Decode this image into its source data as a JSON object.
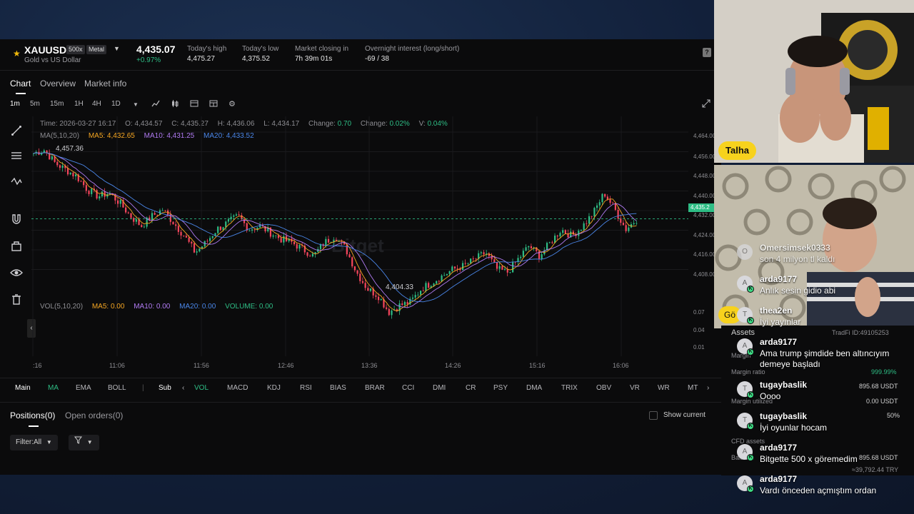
{
  "header": {
    "symbol": "XAUUSD",
    "leverage": "500x",
    "category": "Metal",
    "subtitle": "Gold vs US Dollar",
    "price": "4,435.07",
    "change_pct": "+0.97%",
    "stats": [
      {
        "label": "Today's high",
        "value": "4,475.27"
      },
      {
        "label": "Today's low",
        "value": "4,375.52"
      },
      {
        "label": "Market closing in",
        "value": "7h 39m 01s"
      },
      {
        "label": "Overnight interest (long/short)",
        "value": "-69 / 38"
      }
    ],
    "help": "?"
  },
  "tabs": [
    "Chart",
    "Overview",
    "Market info"
  ],
  "timeframes": [
    "1m",
    "5m",
    "15m",
    "1H",
    "4H",
    "1D"
  ],
  "legend": {
    "time": "Time: 2026-03-27 16:17",
    "open": "O: 4,434.57",
    "close": "C: 4,435.27",
    "high": "H: 4,436.06",
    "low": "L: 4,434.17",
    "change": "Change:",
    "change_val": "0.70",
    "change_pct": "Change:",
    "change_pct_val": "0.02%",
    "v": "V:",
    "v_val": "0.04%",
    "ma_label": "MA(5,10,20)",
    "ma5": "MA5: 4,432.65",
    "ma10": "MA10: 4,431.25",
    "ma20": "MA20: 4,433.52",
    "vol_label": "VOL(5,10,20)",
    "vol_ma5": "MA5: 0.00",
    "vol_ma10": "MA10: 0.00",
    "vol_ma20": "MA20: 0.00",
    "volume": "VOLUME: 0.00"
  },
  "chart_annotations": {
    "high_mark": "4,457.36",
    "low_mark": "4,404.33"
  },
  "chart_data": {
    "type": "candlestick",
    "x_ticks": [
      ":16",
      "11:06",
      "11:56",
      "12:46",
      "13:36",
      "14:26",
      "15:16",
      "16:06"
    ],
    "y_ticks": [
      "4,464.00",
      "4,456.00",
      "4,448.00",
      "4,440.00",
      "4,432.00",
      "4,424.00",
      "4,416.00",
      "4,408.00"
    ],
    "current_price_label": "4,435.2",
    "vol_ticks": [
      "0.07",
      "0.04",
      "0.01"
    ],
    "ylim": [
      4404,
      4464
    ],
    "series": [
      {
        "name": "MA5",
        "color": "#f5a623"
      },
      {
        "name": "MA10",
        "color": "#b07bf2"
      },
      {
        "name": "MA20",
        "color": "#4a86e8"
      }
    ],
    "close_path": [
      4455,
      4456,
      4452,
      4450,
      4448,
      4444,
      4442,
      4443,
      4440,
      4436,
      4433,
      4436,
      4438,
      4434,
      4430,
      4425,
      4428,
      4432,
      4434,
      4436,
      4432,
      4433,
      4431,
      4429,
      4428,
      4426,
      4424,
      4428,
      4430,
      4426,
      4419,
      4414,
      4412,
      4407,
      4409,
      4410,
      4414,
      4416,
      4418,
      4420,
      4421,
      4423,
      4425,
      4420,
      4419,
      4423,
      4427,
      4424,
      4428,
      4432,
      4430,
      4433,
      4437,
      4443,
      4438,
      4432,
      4435
    ]
  },
  "indicators": {
    "main": "Main",
    "main_items": [
      "MA",
      "EMA",
      "BOLL"
    ],
    "sub": "Sub",
    "sub_items": [
      "VOL",
      "MACD",
      "KDJ",
      "RSI",
      "BIAS",
      "BRAR",
      "CCI",
      "DMI",
      "CR",
      "PSY",
      "DMA",
      "TRIX",
      "OBV",
      "VR",
      "WR",
      "MT"
    ]
  },
  "positions": {
    "tabs": [
      "Positions(0)",
      "Open orders(0)"
    ],
    "show_current": "Show current",
    "filter": "Filter:All"
  },
  "assets": {
    "title": "Assets",
    "id": "TradFi ID:49105253",
    "margin": "Margin",
    "margin_ratio": "Margin ratio",
    "margin_ratio_val": "999.99%",
    "row1_val": "895.68 USDT",
    "margin_utilized": "Margin utilized",
    "margin_utilized_val": "0.00 USDT",
    "row3_val": "50%",
    "cfd": "CFD assets",
    "balance": "Balance",
    "balance_val": "895.68 USDT",
    "try_val": "≈39,792.44 TRY"
  },
  "stream": {
    "cam1_name": "Talha",
    "cam2_name": "Gö",
    "chat": [
      {
        "user": "Omersimsek0333",
        "initial": "O",
        "text": "son 4 milyon tl kaldı"
      },
      {
        "user": "arda9177",
        "initial": "A",
        "text": "Anlık sesin gidio abi"
      },
      {
        "user": "thea2en",
        "initial": "T",
        "text": "İyi yayınlar"
      },
      {
        "user": "arda9177",
        "initial": "A",
        "text": "Ama trump şimdide ben altıncıyım demeye başladı"
      },
      {
        "user": "tugaybaslik",
        "initial": "T",
        "text": "Oooo"
      },
      {
        "user": "tugaybaslik",
        "initial": "T",
        "text": "İyi oyunlar hocam"
      },
      {
        "user": "arda9177",
        "initial": "A",
        "text": "Bitgette 500 x göremedim"
      },
      {
        "user": "arda9177",
        "initial": "A",
        "text": "Vardı önceden açmıştım ordan"
      }
    ]
  }
}
